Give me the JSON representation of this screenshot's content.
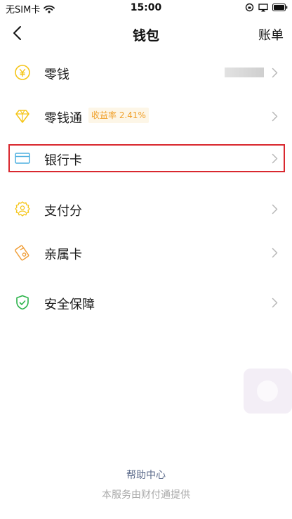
{
  "status_bar": {
    "carrier": "无SIM卡",
    "time": "15:00"
  },
  "nav": {
    "title": "钱包",
    "action_label": "账单"
  },
  "menu": [
    {
      "label": "零钱",
      "icon": "yuan-coin-icon"
    },
    {
      "label": "零钱通",
      "icon": "diamond-icon",
      "badge": "收益率 2.41%"
    },
    {
      "label": "银行卡",
      "icon": "bank-card-icon"
    },
    {
      "label": "支付分",
      "icon": "pay-score-icon"
    },
    {
      "label": "亲属卡",
      "icon": "family-card-icon"
    },
    {
      "label": "安全保障",
      "icon": "shield-check-icon"
    }
  ],
  "footer": {
    "help_label": "帮助中心",
    "provider_note": "本服务由财付通提供"
  },
  "colors": {
    "accent_yellow": "#f5c518",
    "badge_text": "#f0a02a",
    "card_blue": "#4fb0e0",
    "shield_green": "#2bb34a",
    "family_orange": "#f0a03c",
    "highlight_red": "#d9282f",
    "help_link": "#5b6a8a"
  }
}
